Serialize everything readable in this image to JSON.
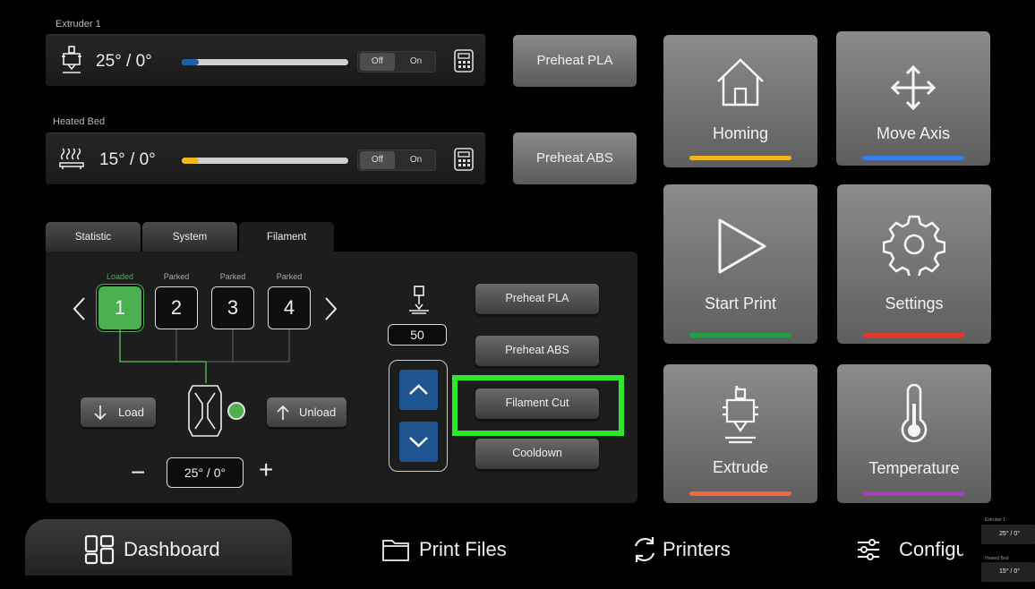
{
  "extruder": {
    "label": "Extruder 1",
    "temp": "25° / 0°",
    "progress": 0.1,
    "toggle_off": "Off",
    "toggle_on": "On",
    "color": "#1e5fa8"
  },
  "bed": {
    "label": "Heated Bed",
    "temp": "15° / 0°",
    "progress": 0.1,
    "toggle_off": "Off",
    "toggle_on": "On",
    "color": "#f0b81e"
  },
  "preheat": {
    "pla": "Preheat PLA",
    "abs": "Preheat ABS"
  },
  "tiles": [
    {
      "label": "Homing",
      "icon": "home-icon",
      "color": "#f2b71a"
    },
    {
      "label": "Move Axis",
      "icon": "move-axis-icon",
      "color": "#3b7de8"
    },
    {
      "label": "Start Print",
      "icon": "play-icon",
      "color": "#1fa14a"
    },
    {
      "label": "Settings",
      "icon": "gear-icon",
      "color": "#e0372f"
    },
    {
      "label": "Extrude",
      "icon": "extruder-icon",
      "color": "#f06a3c"
    },
    {
      "label": "Temperature",
      "icon": "thermometer-icon",
      "color": "#a53fbf"
    }
  ],
  "tabs": [
    "Statistic",
    "System",
    "Filament"
  ],
  "filament": {
    "slots": [
      {
        "number": "1",
        "status": "Loaded"
      },
      {
        "number": "2",
        "status": "Parked"
      },
      {
        "number": "3",
        "status": "Parked"
      },
      {
        "number": "4",
        "status": "Parked"
      }
    ],
    "load": "Load",
    "unload": "Unload",
    "temp": "25° / 0°",
    "minus": "−",
    "plus": "+",
    "extrude_amount": "50",
    "buttons": {
      "preheat_pla": "Preheat PLA",
      "preheat_abs": "Preheat ABS",
      "filament_cut": "Filament Cut",
      "cooldown": "Cooldown"
    },
    "highlight_color": "#2ee82e",
    "slot_active_color": "#4caf50"
  },
  "nav": {
    "dashboard": "Dashboard",
    "print_files": "Print Files",
    "printers": "Printers",
    "config": "Configu"
  },
  "mini": {
    "extruder_label": "Extruder 1",
    "extruder_temp": "25° / 0°",
    "bed_label": "Heated Bed",
    "bed_temp": "15° / 0°"
  }
}
